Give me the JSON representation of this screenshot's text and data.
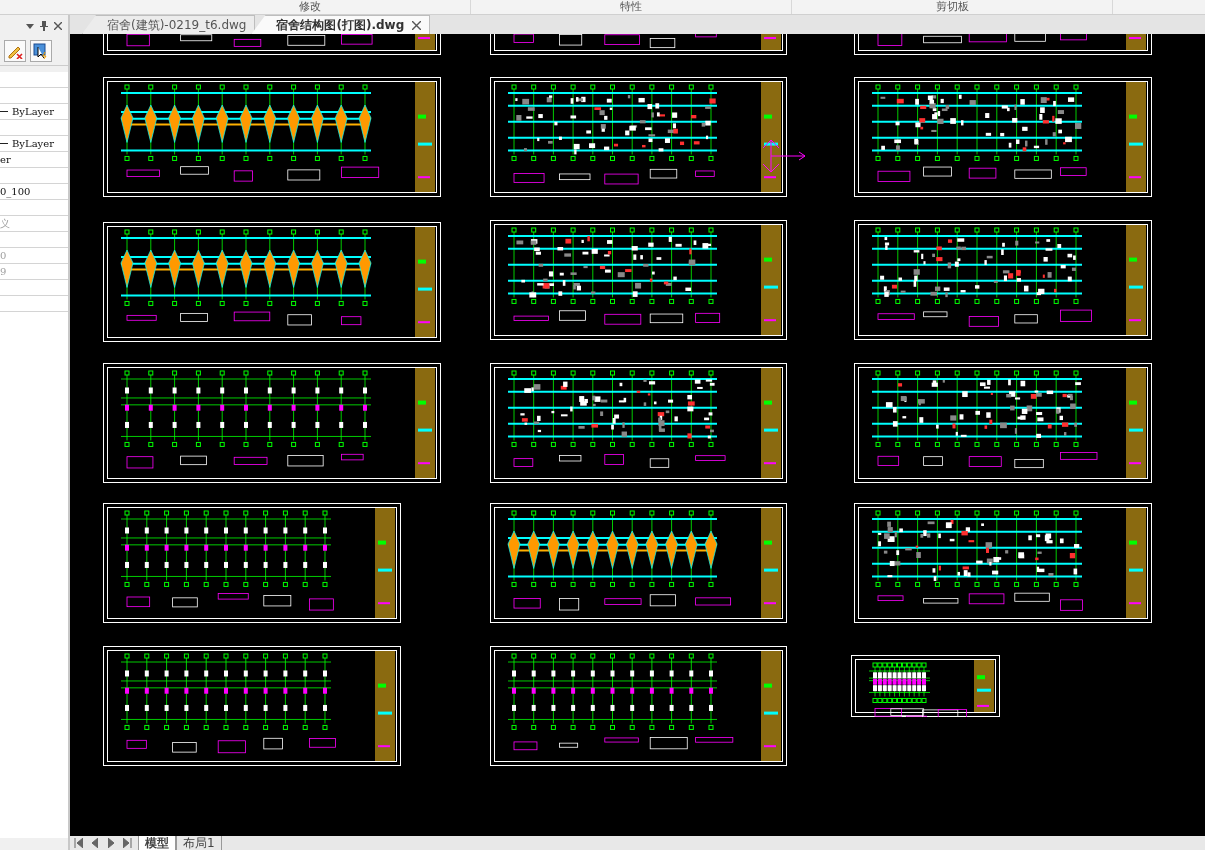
{
  "ribbon_panels": [
    "修改",
    "特性",
    "剪切板"
  ],
  "file_tabs": [
    {
      "label": "宿舍(建筑)-0219_t6.dwg",
      "selected": false
    },
    {
      "label": "宿舍结构图(打图).dwg",
      "selected": true
    }
  ],
  "properties": [
    {
      "kind": "blank"
    },
    {
      "kind": "blank"
    },
    {
      "kind": "linetype",
      "value": "ByLayer",
      "disabled": false
    },
    {
      "kind": "blank"
    },
    {
      "kind": "linetype",
      "value": "ByLayer",
      "disabled": false
    },
    {
      "kind": "value",
      "value": "er",
      "disabled": false
    },
    {
      "kind": "blank"
    },
    {
      "kind": "value",
      "value": "0_100",
      "disabled": false
    },
    {
      "kind": "blank"
    },
    {
      "kind": "value",
      "value": "义",
      "disabled": true
    },
    {
      "kind": "blank"
    },
    {
      "kind": "value",
      "value": "0",
      "disabled": true
    },
    {
      "kind": "value",
      "value": "9",
      "disabled": true
    },
    {
      "kind": "blank"
    },
    {
      "kind": "blank"
    }
  ],
  "layout_tabs": [
    {
      "label": "模型",
      "selected": true
    },
    {
      "label": "布局1",
      "selected": false
    }
  ]
}
